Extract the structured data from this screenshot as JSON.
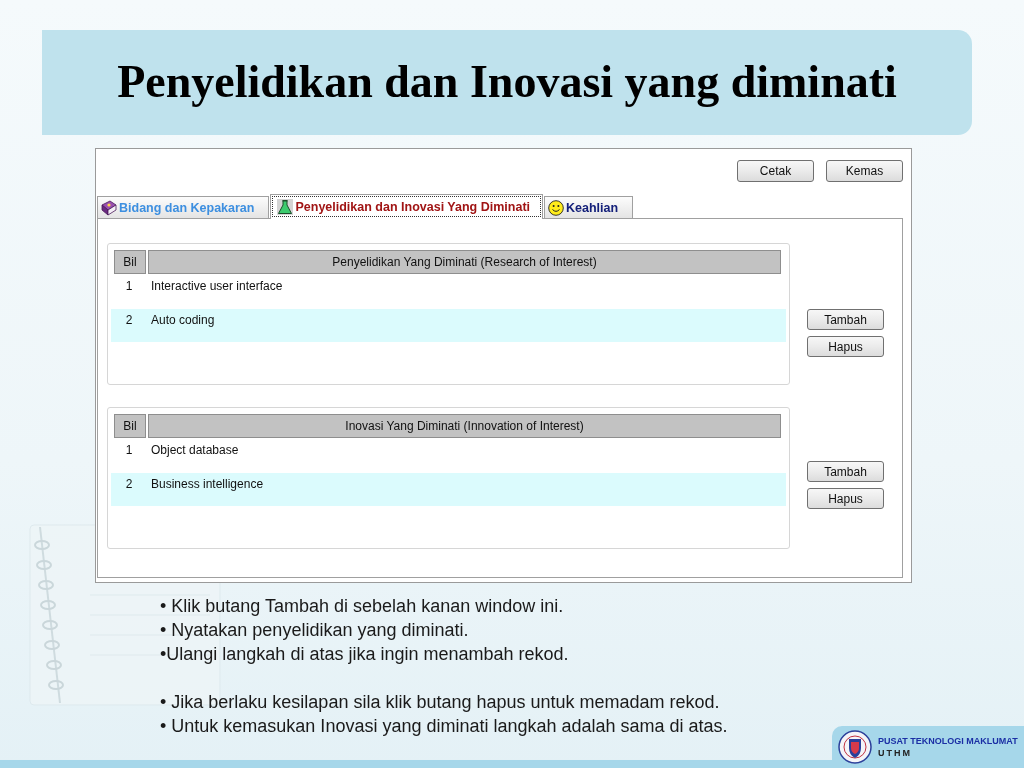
{
  "slide": {
    "title": "Penyelidikan dan Inovasi yang diminati"
  },
  "window": {
    "toolbar_buttons": [
      "Cetak",
      "Kemas"
    ],
    "tabs": [
      {
        "label": "Bidang dan Kepakaran",
        "selected": false,
        "color": "#3d8fe0"
      },
      {
        "label": "Penyelidikan dan Inovasi Yang Diminati",
        "selected": true,
        "color": "#a01414"
      },
      {
        "label": "Keahlian",
        "selected": false,
        "color": "#14207a"
      }
    ],
    "sections": [
      {
        "table": {
          "columns": [
            "Bil",
            "Penyelidikan Yang Diminati (Research of Interest)"
          ],
          "rows": [
            [
              "1",
              "Interactive user interface"
            ],
            [
              "2",
              "Auto coding"
            ]
          ]
        },
        "buttons": [
          "Tambah",
          "Hapus"
        ]
      },
      {
        "table": {
          "columns": [
            "Bil",
            "Inovasi Yang Diminati (Innovation of Interest)"
          ],
          "rows": [
            [
              "1",
              "Object database"
            ],
            [
              "2",
              "Business intelligence"
            ]
          ]
        },
        "buttons": [
          "Tambah",
          "Hapus"
        ]
      }
    ]
  },
  "instructions": [
    [
      "• Klik butang Tambah di sebelah kanan window ini.",
      "• Nyatakan penyelidikan yang diminati.",
      "•Ulangi langkah di atas jika ingin menambah rekod."
    ],
    [
      "• Jika berlaku kesilapan sila klik butang hapus untuk memadam rekod.",
      "• Untuk kemasukan Inovasi yang diminati langkah adalah sama di atas."
    ]
  ],
  "footer": {
    "logo_lines": [
      "PUSAT TEKNOLOGI MAKLUMAT",
      "UTHM"
    ]
  }
}
